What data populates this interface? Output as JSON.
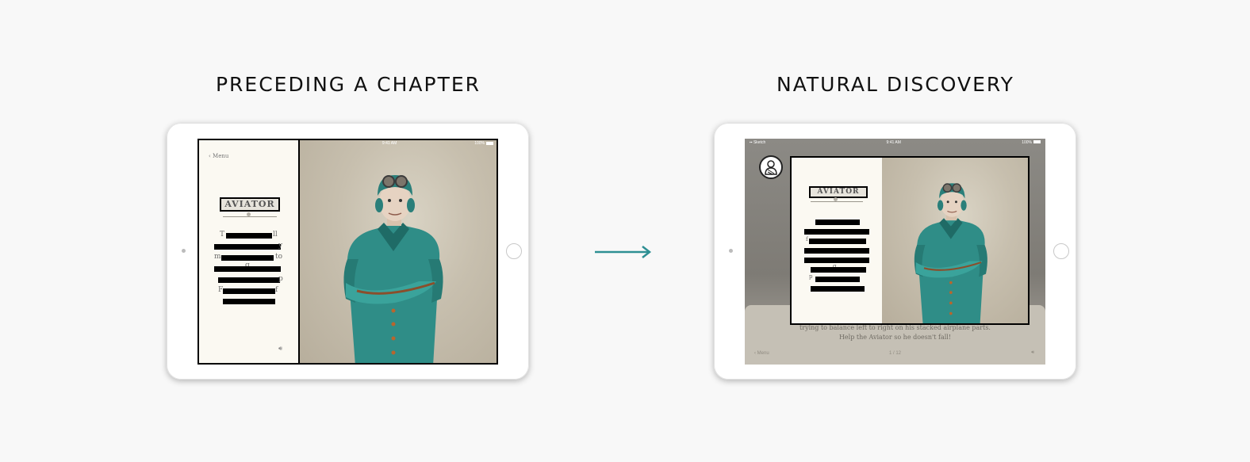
{
  "titles": {
    "left": "PRECEDING A CHAPTER",
    "right": "NATURAL DISCOVERY"
  },
  "arrow_color": "#2e8f93",
  "left_ipad": {
    "status_time": "9:41 AM",
    "status_battery": "100%",
    "back_label": "Menu",
    "logo_text": "AVIATOR",
    "text_fragments": [
      "T",
      "ll",
      "y",
      "m",
      "to",
      "g",
      "p",
      "F",
      "f"
    ],
    "sound_icon": "speaker-icon"
  },
  "right_ipad": {
    "status_carrier": "Sketch",
    "status_time": "9:41 AM",
    "status_battery": "100%",
    "logo_text": "AVIATOR",
    "text_fragments": [
      "f",
      "g",
      "p"
    ],
    "caption_line1": "trying to balance left to right on his stacked airplane parts.",
    "caption_line2": "Help the Aviator so he doesn't fall!",
    "back_label": "Menu",
    "page_indicator": "1 / 12",
    "profile_icon": "aviator-profile-icon"
  }
}
